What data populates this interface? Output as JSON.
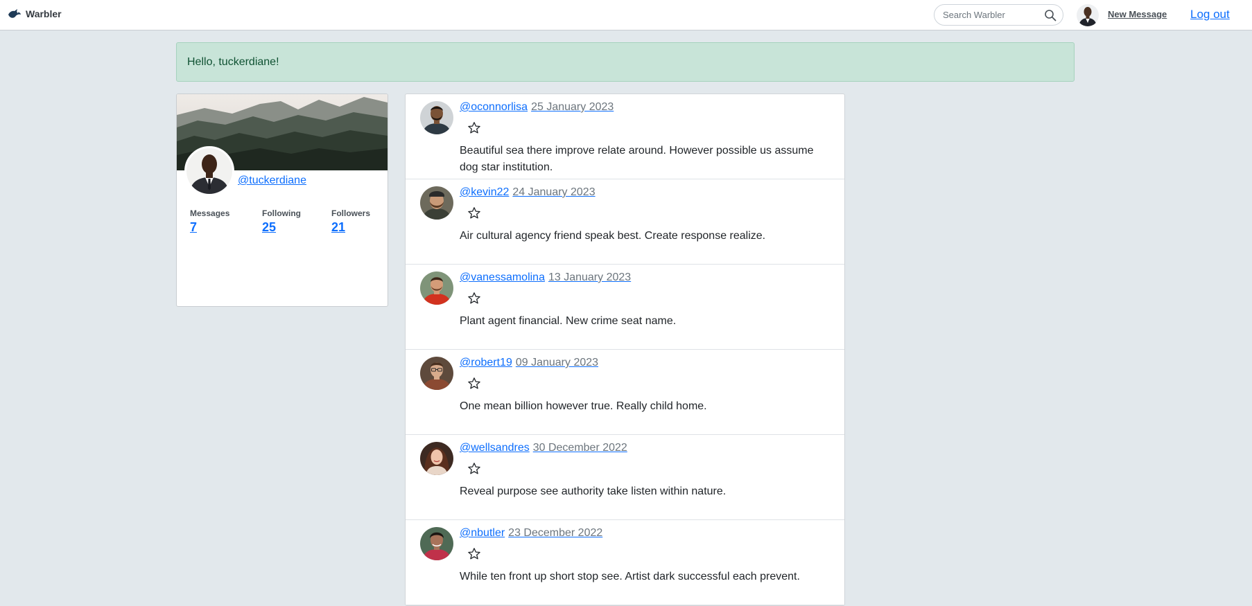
{
  "navbar": {
    "brand": "Warbler",
    "search_placeholder": "Search Warbler",
    "new_message": "New Message",
    "logout": "Log out"
  },
  "alert": {
    "text": "Hello, tuckerdiane!"
  },
  "profile": {
    "handle": "@tuckerdiane",
    "stats": [
      {
        "label": "Messages",
        "value": "7"
      },
      {
        "label": "Following",
        "value": "25"
      },
      {
        "label": "Followers",
        "value": "21"
      }
    ]
  },
  "messages": [
    {
      "handle": "@oconnorlisa",
      "date": "25 January 2023",
      "text": "Beautiful sea there improve relate around. However possible us assume dog star institution."
    },
    {
      "handle": "@kevin22",
      "date": "24 January 2023",
      "text": "Air cultural agency friend speak best. Create response realize."
    },
    {
      "handle": "@vanessamolina",
      "date": "13 January 2023",
      "text": "Plant agent financial. New crime seat name."
    },
    {
      "handle": "@robert19",
      "date": "09 January 2023",
      "text": "One mean billion however true. Really child home."
    },
    {
      "handle": "@wellsandres",
      "date": "30 December 2022",
      "text": "Reveal purpose see authority take listen within nature."
    },
    {
      "handle": "@nbutler",
      "date": "23 December 2022",
      "text": "While ten front up short stop see. Artist dark successful each prevent."
    }
  ],
  "colors": {
    "page_background": "#e2e8ec",
    "link": "#0d6efd",
    "alert_background": "#c8e4d8",
    "alert_text": "#0f5132"
  }
}
